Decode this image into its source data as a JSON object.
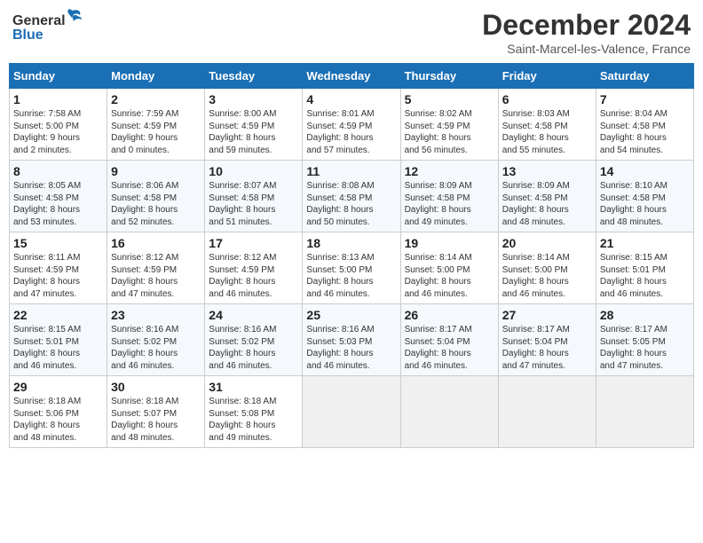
{
  "header": {
    "logo_general": "General",
    "logo_blue": "Blue",
    "month_title": "December 2024",
    "location": "Saint-Marcel-les-Valence, France"
  },
  "days_of_week": [
    "Sunday",
    "Monday",
    "Tuesday",
    "Wednesday",
    "Thursday",
    "Friday",
    "Saturday"
  ],
  "weeks": [
    [
      {
        "day": "1",
        "info": "Sunrise: 7:58 AM\nSunset: 5:00 PM\nDaylight: 9 hours\nand 2 minutes."
      },
      {
        "day": "2",
        "info": "Sunrise: 7:59 AM\nSunset: 4:59 PM\nDaylight: 9 hours\nand 0 minutes."
      },
      {
        "day": "3",
        "info": "Sunrise: 8:00 AM\nSunset: 4:59 PM\nDaylight: 8 hours\nand 59 minutes."
      },
      {
        "day": "4",
        "info": "Sunrise: 8:01 AM\nSunset: 4:59 PM\nDaylight: 8 hours\nand 57 minutes."
      },
      {
        "day": "5",
        "info": "Sunrise: 8:02 AM\nSunset: 4:59 PM\nDaylight: 8 hours\nand 56 minutes."
      },
      {
        "day": "6",
        "info": "Sunrise: 8:03 AM\nSunset: 4:58 PM\nDaylight: 8 hours\nand 55 minutes."
      },
      {
        "day": "7",
        "info": "Sunrise: 8:04 AM\nSunset: 4:58 PM\nDaylight: 8 hours\nand 54 minutes."
      }
    ],
    [
      {
        "day": "8",
        "info": "Sunrise: 8:05 AM\nSunset: 4:58 PM\nDaylight: 8 hours\nand 53 minutes."
      },
      {
        "day": "9",
        "info": "Sunrise: 8:06 AM\nSunset: 4:58 PM\nDaylight: 8 hours\nand 52 minutes."
      },
      {
        "day": "10",
        "info": "Sunrise: 8:07 AM\nSunset: 4:58 PM\nDaylight: 8 hours\nand 51 minutes."
      },
      {
        "day": "11",
        "info": "Sunrise: 8:08 AM\nSunset: 4:58 PM\nDaylight: 8 hours\nand 50 minutes."
      },
      {
        "day": "12",
        "info": "Sunrise: 8:09 AM\nSunset: 4:58 PM\nDaylight: 8 hours\nand 49 minutes."
      },
      {
        "day": "13",
        "info": "Sunrise: 8:09 AM\nSunset: 4:58 PM\nDaylight: 8 hours\nand 48 minutes."
      },
      {
        "day": "14",
        "info": "Sunrise: 8:10 AM\nSunset: 4:58 PM\nDaylight: 8 hours\nand 48 minutes."
      }
    ],
    [
      {
        "day": "15",
        "info": "Sunrise: 8:11 AM\nSunset: 4:59 PM\nDaylight: 8 hours\nand 47 minutes."
      },
      {
        "day": "16",
        "info": "Sunrise: 8:12 AM\nSunset: 4:59 PM\nDaylight: 8 hours\nand 47 minutes."
      },
      {
        "day": "17",
        "info": "Sunrise: 8:12 AM\nSunset: 4:59 PM\nDaylight: 8 hours\nand 46 minutes."
      },
      {
        "day": "18",
        "info": "Sunrise: 8:13 AM\nSunset: 5:00 PM\nDaylight: 8 hours\nand 46 minutes."
      },
      {
        "day": "19",
        "info": "Sunrise: 8:14 AM\nSunset: 5:00 PM\nDaylight: 8 hours\nand 46 minutes."
      },
      {
        "day": "20",
        "info": "Sunrise: 8:14 AM\nSunset: 5:00 PM\nDaylight: 8 hours\nand 46 minutes."
      },
      {
        "day": "21",
        "info": "Sunrise: 8:15 AM\nSunset: 5:01 PM\nDaylight: 8 hours\nand 46 minutes."
      }
    ],
    [
      {
        "day": "22",
        "info": "Sunrise: 8:15 AM\nSunset: 5:01 PM\nDaylight: 8 hours\nand 46 minutes."
      },
      {
        "day": "23",
        "info": "Sunrise: 8:16 AM\nSunset: 5:02 PM\nDaylight: 8 hours\nand 46 minutes."
      },
      {
        "day": "24",
        "info": "Sunrise: 8:16 AM\nSunset: 5:02 PM\nDaylight: 8 hours\nand 46 minutes."
      },
      {
        "day": "25",
        "info": "Sunrise: 8:16 AM\nSunset: 5:03 PM\nDaylight: 8 hours\nand 46 minutes."
      },
      {
        "day": "26",
        "info": "Sunrise: 8:17 AM\nSunset: 5:04 PM\nDaylight: 8 hours\nand 46 minutes."
      },
      {
        "day": "27",
        "info": "Sunrise: 8:17 AM\nSunset: 5:04 PM\nDaylight: 8 hours\nand 47 minutes."
      },
      {
        "day": "28",
        "info": "Sunrise: 8:17 AM\nSunset: 5:05 PM\nDaylight: 8 hours\nand 47 minutes."
      }
    ],
    [
      {
        "day": "29",
        "info": "Sunrise: 8:18 AM\nSunset: 5:06 PM\nDaylight: 8 hours\nand 48 minutes."
      },
      {
        "day": "30",
        "info": "Sunrise: 8:18 AM\nSunset: 5:07 PM\nDaylight: 8 hours\nand 48 minutes."
      },
      {
        "day": "31",
        "info": "Sunrise: 8:18 AM\nSunset: 5:08 PM\nDaylight: 8 hours\nand 49 minutes."
      },
      null,
      null,
      null,
      null
    ]
  ]
}
